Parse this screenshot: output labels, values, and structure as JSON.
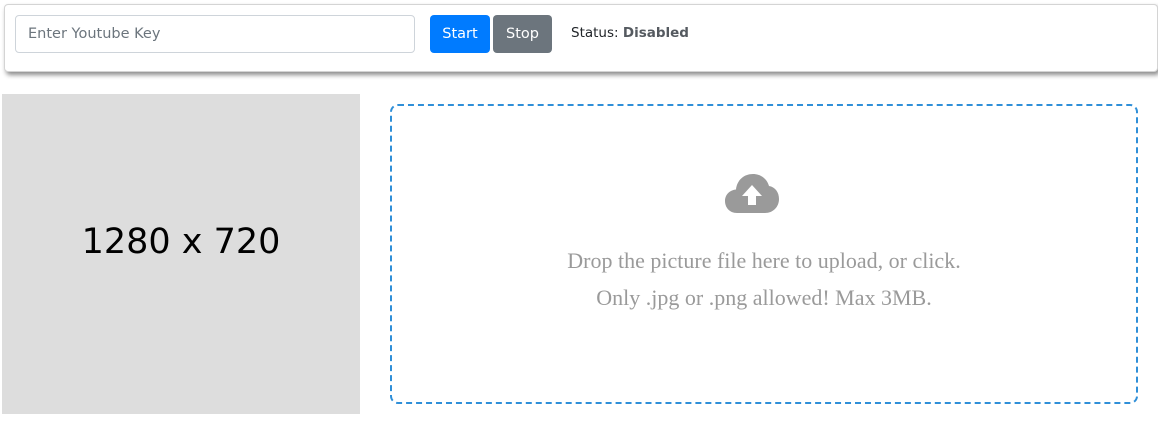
{
  "toolbar": {
    "key_input": {
      "value": "",
      "placeholder": "Enter Youtube Key"
    },
    "start_label": "Start",
    "stop_label": "Stop",
    "status_label": "Status:",
    "status_value": "Disabled"
  },
  "preview": {
    "placeholder_text": "1280 x 720"
  },
  "dropzone": {
    "icon": "cloud-upload-icon",
    "line1": "Drop the picture file here to upload, or click.",
    "line2": "Only .jpg or .png allowed! Max 3MB."
  },
  "colors": {
    "start_button": "#007bff",
    "stop_button": "#6c757d",
    "dropzone_border": "#2f8fd8",
    "preview_background": "#dddddd",
    "muted_text": "#9a9a9a"
  }
}
